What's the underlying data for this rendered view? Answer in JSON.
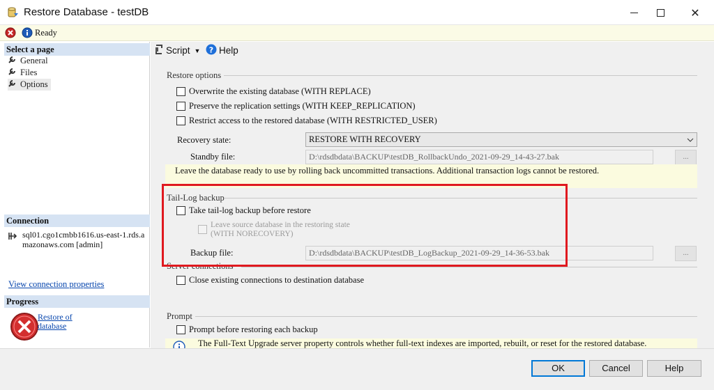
{
  "window": {
    "title": "Restore Database - testDB",
    "minimize_glyph": "—",
    "maximize_glyph": "☐",
    "close_glyph": "✕"
  },
  "status": {
    "text": "Ready"
  },
  "left_panel": {
    "select_page_header": "Select a page",
    "pages": [
      "General",
      "Files",
      "Options"
    ],
    "connection_header": "Connection",
    "connection_line1": "sql01.cgo1cmbb1616.us-east-1.rds.a",
    "connection_line2": "mazonaws.com [admin]",
    "view_connection_link": "View connection properties",
    "progress_header": "Progress",
    "progress_link_line1": "Restore of",
    "progress_link_line2": "database"
  },
  "toolbar": {
    "script_label": "Script",
    "help_label": "Help"
  },
  "restore_options": {
    "group_label": "Restore options",
    "overwrite": "Overwrite the existing database (WITH REPLACE)",
    "preserve": "Preserve the replication settings (WITH KEEP_REPLICATION)",
    "restrict": "Restrict access to the restored database (WITH RESTRICTED_USER)",
    "recovery_state_label": "Recovery state:",
    "recovery_state_value": "RESTORE WITH RECOVERY",
    "standby_label": "Standby file:",
    "standby_value": "D:\\rdsdbdata\\BACKUP\\testDB_RollbackUndo_2021-09-29_14-43-27.bak",
    "browse_label": "...",
    "note": "Leave the database ready to use by rolling back uncommitted transactions. Additional transaction logs cannot be restored."
  },
  "tail_log": {
    "group_label": "Tail-Log backup",
    "take_backup": "Take tail-log backup before restore",
    "leave_source_line1": "Leave source database in the restoring state",
    "leave_source_line2": "(WITH NORECOVERY)",
    "backup_file_label": "Backup file:",
    "backup_file_value": "D:\\rdsdbdata\\BACKUP\\testDB_LogBackup_2021-09-29_14-36-53.bak",
    "browse_label": "..."
  },
  "server_connections": {
    "group_label": "Server connections",
    "close_existing": "Close existing connections to destination database"
  },
  "prompt": {
    "group_label": "Prompt",
    "prompt_before": "Prompt before restoring each backup",
    "info_note": "The Full-Text Upgrade server property controls whether full-text indexes are imported, rebuilt, or reset for the restored database."
  },
  "buttons": {
    "ok": "OK",
    "cancel": "Cancel",
    "help": "Help"
  },
  "colors": {
    "highlight_box": "#e0191f",
    "section_header": "#d6e3f3",
    "note_background": "#fbfbdf",
    "link": "#0645ad",
    "default_button_border": "#0078d7"
  }
}
